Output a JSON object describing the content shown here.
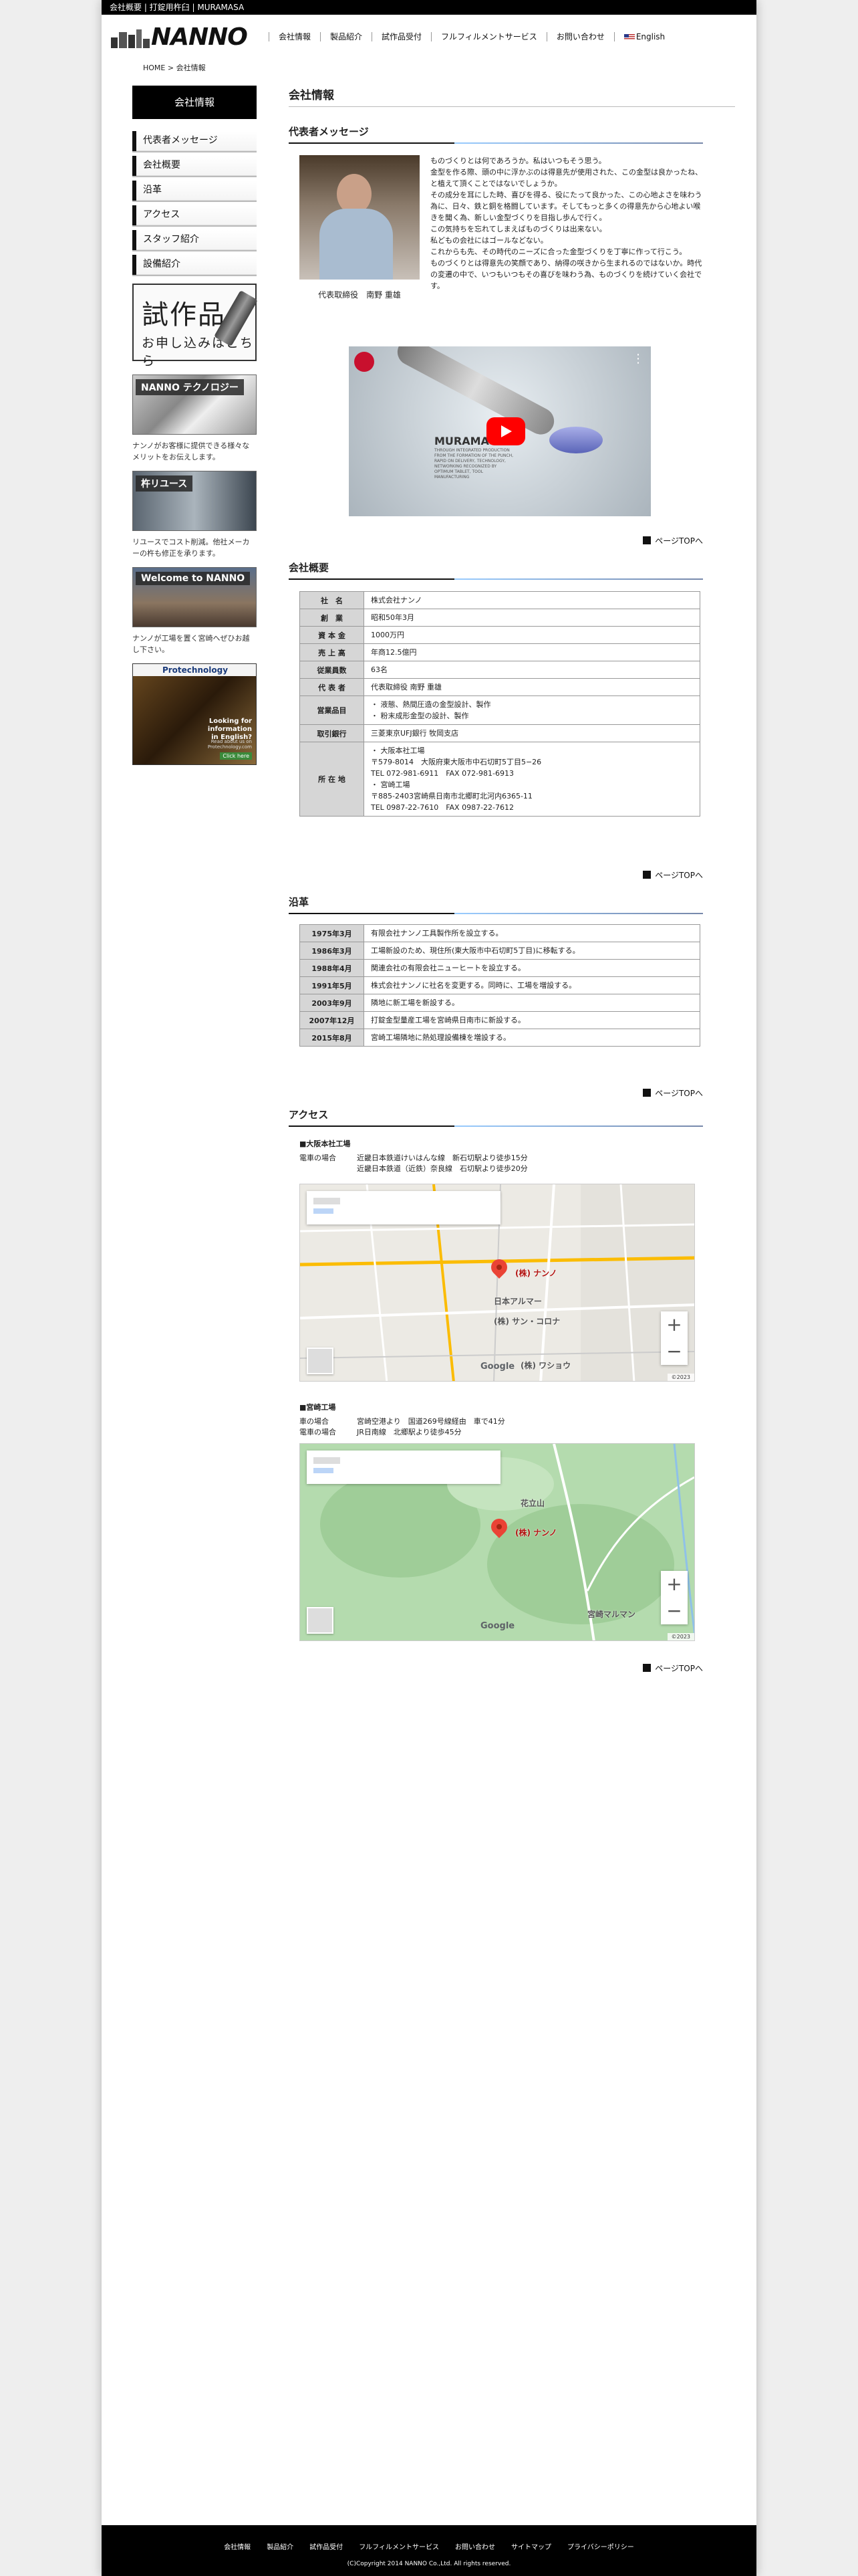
{
  "topbar": {
    "text": "会社概要 | 打錠用杵臼 | MURAMASA"
  },
  "logo": {
    "text": "NANNO"
  },
  "gnav": [
    {
      "label": "会社情報"
    },
    {
      "label": "製品紹介"
    },
    {
      "label": "試作品受付"
    },
    {
      "label": "フルフィルメントサービス"
    },
    {
      "label": "お問い合わせ"
    },
    {
      "label": "English"
    }
  ],
  "breadcrumb": "HOME > 会社情報",
  "sidebar": {
    "heading": "会社情報",
    "items": [
      {
        "label": "代表者メッセージ"
      },
      {
        "label": "会社概要"
      },
      {
        "label": "沿革"
      },
      {
        "label": "アクセス"
      },
      {
        "label": "スタッフ紹介"
      },
      {
        "label": "設備紹介"
      }
    ]
  },
  "banners": {
    "shisaku_big": "試作品",
    "shisaku_small": "お申し込みはこちら",
    "tech_label": "NANNO テクノロジー",
    "tech_caption": "ナンノがお客様に提供できる様々なメリットをお伝えします。",
    "reuse_label": "杵リユース",
    "reuse_caption": "リユースでコスト削減。他社メーカーの杵も修正を承ります。",
    "welcome_label": "Welcome to NANNO",
    "welcome_caption": "ナンノが工場を置く宮崎へぜひお越し下さい。",
    "protech_logo": "Protechnology",
    "protech_q": "Looking for information in English?",
    "protech_a": "Read about us on Protechnology.com",
    "protech_link": "Click here"
  },
  "main": {
    "title": "会社情報"
  },
  "message": {
    "heading": "代表者メッセージ",
    "caption": "代表取締役　南野 重雄",
    "paragraphs": [
      "ものづくりとは何であろうか。私はいつもそう思う。",
      "金型を作る際、頭の中に浮かぶのは得意先が使用された、この金型は良かったね、と植えて頂くことではないでしょうか。",
      "その成分を耳にした時、喜びを得る、役にたって良かった、この心地よさを味わう為に、日々、鉄と銅を格闘しています。そしてもっと多くの得意先から心地よい喉きを聞く為、新しい金型づくりを目指し歩んで行く。",
      "この気持ちを忘れてしまえばものづくりは出来ない。",
      "私どもの会社にはゴールなどない。",
      "これからも先、その時代のニーズに合った金型づくりを丁寧に作って行こう。",
      "ものづくりとは得意先の笑顔であり、納得の咲きから生まれるのではないか。時代の変遷の中で、いつもいつもその喜びを味わう為、ものづくりを続けていく会社です。"
    ]
  },
  "video": {
    "text1": "MURAMASA",
    "text2": "THROUGH INTEGRATED PRODUCTION FROM THE FORMATION OF THE PUNCH, RAPID ON DELIVERY, TECHNOLOGY, NETWORKING RECOGNIZED BY OPTIMUM TABLET, TOOL MANUFACTURING"
  },
  "pagetop": "ページTOPへ",
  "overview": {
    "heading": "会社概要",
    "rows": [
      {
        "k": "社　名",
        "v": "株式会社ナンノ"
      },
      {
        "k": "創　業",
        "v": "昭和50年3月"
      },
      {
        "k": "資 本 金",
        "v": "1000万円"
      },
      {
        "k": "売 上 高",
        "v": "年商12.5億円"
      },
      {
        "k": "従業員数",
        "v": "63名"
      },
      {
        "k": "代 表 者",
        "v": "代表取締役 南野 重雄"
      },
      {
        "k": "営業品目",
        "v": "・ 液態、熱間圧造の金型設計、製作\n・ 粉末成形金型の設計、製作"
      },
      {
        "k": "取引銀行",
        "v": "三菱東京UFJ銀行 牧岡支店"
      },
      {
        "k": "所 在 地",
        "v": "・ 大阪本社工場\n〒579-8014　大阪府東大阪市中石切町5丁目5−26\nTEL 072-981-6911　FAX 072-981-6913\n・ 宮崎工場\n〒885-2403宮崎県日南市北郷町北河内6365-11\nTEL 0987-22-7610　FAX 0987-22-7612"
      }
    ]
  },
  "history": {
    "heading": "沿革",
    "rows": [
      {
        "k": "1975年3月",
        "v": "有限会社ナンノ工具製作所を設立する。"
      },
      {
        "k": "1986年3月",
        "v": "工場新設のため、現住所(東大阪市中石切町5丁目)に移転する。"
      },
      {
        "k": "1988年4月",
        "v": "関連会社の有限会社ニューヒートを設立する。"
      },
      {
        "k": "1991年5月",
        "v": "株式会社ナンノに社名を変更する。同時に、工場を増設する。"
      },
      {
        "k": "2003年9月",
        "v": "隣地に新工場を新設する。"
      },
      {
        "k": "2007年12月",
        "v": "打錠金型量産工場を宮崎県日南市に新設する。"
      },
      {
        "k": "2015年8月",
        "v": "宮崎工場隣地に熱処理設備棟を増設する。"
      }
    ]
  },
  "access": {
    "heading": "アクセス",
    "osaka": {
      "title": "■大阪本社工場",
      "rows": [
        {
          "k": "電車の場合",
          "v": "近畿日本鉄道けいはんな線　新石切駅より徒歩15分"
        },
        {
          "k": "",
          "v": "近畿日本鉄道（近鉄）奈良線　石切駅より徒歩20分"
        }
      ],
      "map_label1": "(株) ナンノ",
      "map_label2": "日本アルマー",
      "map_label3": "(株) サン・コロナ",
      "map_label4": "(株) ワショウ",
      "google": "Google"
    },
    "miyazaki": {
      "title": "■宮崎工場",
      "rows": [
        {
          "k": "車の場合",
          "v": "宮崎空港より　国道269号線経由　車で41分"
        },
        {
          "k": "電車の場合",
          "v": "JR日南線　北郷駅より徒歩45分"
        }
      ],
      "map_label1": "(株) ナンノ",
      "map_label2": "宮崎マルマン",
      "map_label3": "花立山",
      "google": "Google"
    }
  },
  "footer": {
    "links": [
      {
        "label": "会社情報"
      },
      {
        "label": "製品紹介"
      },
      {
        "label": "試作品受付"
      },
      {
        "label": "フルフィルメントサービス"
      },
      {
        "label": "お問い合わせ"
      },
      {
        "label": "サイトマップ"
      },
      {
        "label": "プライバシーポリシー"
      }
    ],
    "copyright": "(C)Copyright 2014 NANNO Co.,Ltd. All rights reserved."
  },
  "colors": {
    "accent": "#000000",
    "underline_blue": "#99ccff",
    "map_green": "#a8d5a2",
    "pin_red": "#ea4335"
  }
}
